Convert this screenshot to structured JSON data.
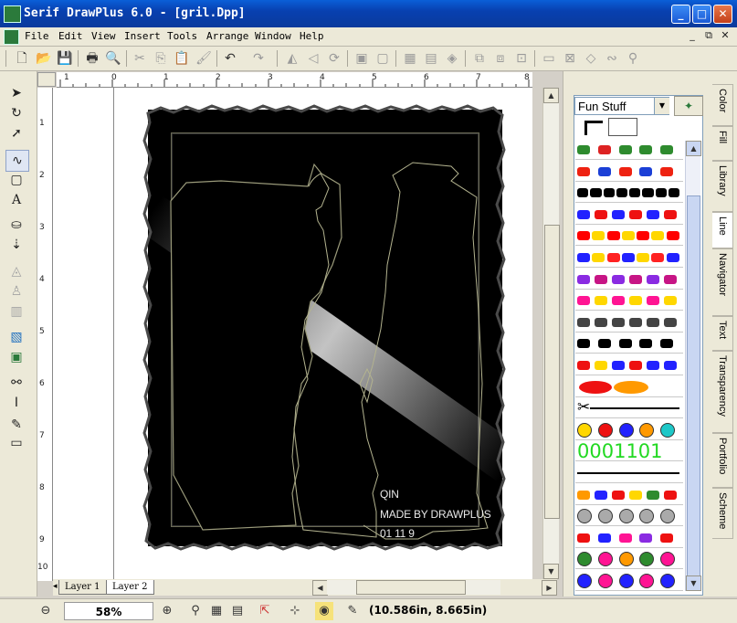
{
  "window": {
    "title": "Serif DrawPlus 6.0 - [gril.Dpp]"
  },
  "menu": [
    {
      "label": "File"
    },
    {
      "label": "Edit"
    },
    {
      "label": "View"
    },
    {
      "label": "Insert"
    },
    {
      "label": "Tools"
    },
    {
      "label": "Arrange"
    },
    {
      "label": "Window"
    },
    {
      "label": "Help"
    }
  ],
  "ruler": {
    "h_ticks": [
      "1",
      "0",
      "1",
      "2",
      "3",
      "4",
      "5",
      "6",
      "7",
      "8"
    ],
    "v_ticks": [
      "1",
      "2",
      "3",
      "4",
      "5",
      "6",
      "7",
      "8",
      "9",
      "10"
    ]
  },
  "artwork": {
    "caption_lines": [
      "QIN",
      "MADE BY DRAWPLUS",
      "01 11 9"
    ]
  },
  "layers": {
    "tabs": [
      "Layer 1",
      "Layer 2"
    ],
    "active": "Layer 2"
  },
  "gallery": {
    "category": "Fun Stuff",
    "text_swatch": "0001101",
    "swatches": [
      {
        "name": "birds",
        "colors": [
          "#2e8b2e",
          "#d22",
          "#2e8b2e",
          "#2e8b2e",
          "#2e8b2e"
        ]
      },
      {
        "name": "lips-ovals",
        "colors": [
          "#e21",
          "#1b3fd6",
          "#e21",
          "#1b3fd6",
          "#e21"
        ]
      },
      {
        "name": "hooks",
        "colors": [
          "#000",
          "#000",
          "#000",
          "#000",
          "#000",
          "#000",
          "#000",
          "#000"
        ]
      },
      {
        "name": "splat-mix",
        "colors": [
          "#22f",
          "#e11",
          "#22f",
          "#e11",
          "#22f",
          "#e11"
        ]
      },
      {
        "name": "red-yellow-flags",
        "colors": [
          "#f00",
          "#ffd700",
          "#f00",
          "#ffd700",
          "#f00",
          "#ffd700",
          "#f00"
        ]
      },
      {
        "name": "gem-mix",
        "colors": [
          "#22f",
          "#ffd700",
          "#f22",
          "#22f",
          "#ffd700",
          "#f22",
          "#22f"
        ]
      },
      {
        "name": "purple-splats",
        "colors": [
          "#8a2be2",
          "#c71585",
          "#8a2be2",
          "#c71585",
          "#8a2be2",
          "#c71585"
        ]
      },
      {
        "name": "pink-bursts",
        "colors": [
          "#ff1493",
          "#ffd700",
          "#ff1493",
          "#ffd700",
          "#ff1493",
          "#ffd700"
        ]
      },
      {
        "name": "arrows",
        "colors": [
          "#444",
          "#444",
          "#444",
          "#444",
          "#444",
          "#444"
        ]
      },
      {
        "name": "black-splats",
        "colors": [
          "#000",
          "#000",
          "#000",
          "#000",
          "#000"
        ]
      },
      {
        "name": "puzzle",
        "colors": [
          "#e11",
          "#ffd700",
          "#22f",
          "#e11",
          "#22f",
          "#22f"
        ]
      },
      {
        "name": "ovals-red-orange",
        "colors": [
          "#e11",
          "#f90"
        ]
      },
      {
        "name": "scissors",
        "colors": [
          "#000",
          "#000",
          "#000"
        ]
      },
      {
        "name": "smileys",
        "colors": [
          "#ffd700",
          "#e11",
          "#22f",
          "#f90",
          "#1ec8c8"
        ]
      },
      {
        "name": "digits",
        "colors": [
          "#22d922"
        ]
      },
      {
        "name": "barbed-wire",
        "colors": [
          "#000"
        ]
      },
      {
        "name": "flowers",
        "colors": [
          "#f90",
          "#22f",
          "#e11",
          "#ffd700",
          "#2e8b2e",
          "#e11"
        ]
      },
      {
        "name": "silver-discs",
        "colors": [
          "#aaa",
          "#aaa",
          "#aaa",
          "#aaa",
          "#aaa"
        ]
      },
      {
        "name": "dice",
        "colors": [
          "#e11",
          "#22f",
          "#ff1493",
          "#8a2be2",
          "#e11"
        ]
      },
      {
        "name": "spirals",
        "colors": [
          "#2e8b2e",
          "#ff1493",
          "#f90",
          "#2e8b2e",
          "#ff1493"
        ]
      },
      {
        "name": "rings",
        "colors": [
          "#22f",
          "#ff1493",
          "#22f",
          "#ff1493",
          "#22f"
        ]
      }
    ]
  },
  "side_tabs": [
    "Color",
    "Fill",
    "Library",
    "Line",
    "Navigator",
    "Text",
    "Transparency",
    "Portfolio",
    "Scheme"
  ],
  "status": {
    "zoom": "58%",
    "coords": "(10.586in, 8.665in)"
  },
  "icons": {
    "toolbar": [
      "new-icon",
      "open-icon",
      "save-icon",
      "print-icon",
      "print-preview-icon",
      "cut-icon",
      "copy-icon",
      "paste-icon",
      "format-painter-icon",
      "undo-icon",
      "redo-icon",
      "flip-h-icon",
      "flip-v-icon",
      "rotate-icon",
      "bring-front-icon",
      "send-back-icon",
      "group-icon",
      "ungroup-icon",
      "combine-icon",
      "add-shapes-icon",
      "subtract-icon",
      "intersect-icon",
      "crop-icon",
      "envelope-icon",
      "blend-icon",
      "connector-icon",
      "snap-icon"
    ],
    "tools": [
      "pointer-icon",
      "rotate-tool-icon",
      "node-icon",
      "curve-icon",
      "shape-icon",
      "text-icon",
      "fill-tool-icon",
      "transparency-tool-icon",
      "envelope-tool-icon",
      "shadow-tool-icon",
      "picture-icon",
      "frame-icon",
      "connector-tool-icon",
      "dimension-icon",
      "pen-icon",
      "crop-tool-icon"
    ]
  }
}
